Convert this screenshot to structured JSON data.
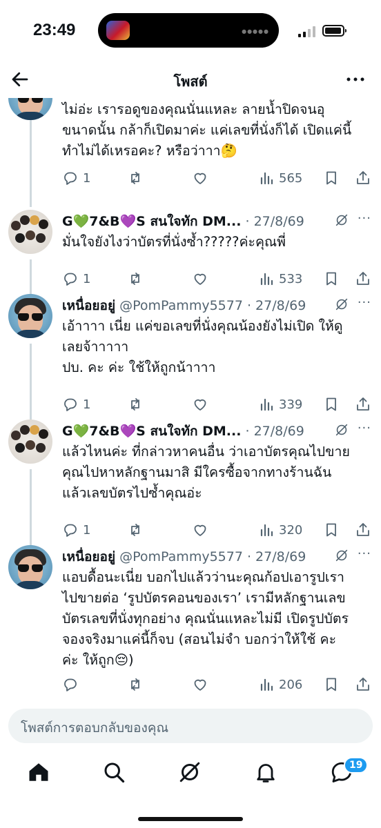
{
  "status_bar": {
    "time": "23:49"
  },
  "header": {
    "title": "โพสต์"
  },
  "icons": {
    "back": "arrow-left-icon",
    "more": "ellipsis-icon",
    "reply": "reply-icon",
    "repost": "repost-icon",
    "like": "heart-icon",
    "views": "views-icon",
    "bookmark": "bookmark-icon",
    "share": "share-icon",
    "grok": "grok-icon",
    "home": "home-icon",
    "search": "search-icon",
    "notifications": "bell-icon",
    "messages": "messages-icon"
  },
  "colors": {
    "text": "#0f1419",
    "secondary": "#536471",
    "accent": "#1d9bf0",
    "thread_line": "#cfd9de",
    "reply_bg": "#eff3f4"
  },
  "tweets": [
    {
      "display_name": "",
      "meta": "",
      "lines": [
        "ไม่อ่ะ เรารอดูของคุณนั่นแหละ ลายน้ำปิดจนอุ",
        "ขนาดนั้น กล้าก็เปิดมาค่ะ แค่เลขที่นั่งก็ได้ เปิดแค่นี้",
        "ทำไม่ได้เหรอคะ? หรือว่าาา🤔"
      ],
      "stats": {
        "replies": "1",
        "reposts": "",
        "likes": "",
        "views": "565"
      }
    },
    {
      "display_name": "G💚7&B💜S สนใจทัก DM...",
      "meta": " · 27/8/69",
      "lines": [
        "มั่นใจยังไงว่าบัตรที่นั่งซ้ำ?????ค่ะคุณพี่"
      ],
      "stats": {
        "replies": "1",
        "reposts": "",
        "likes": "",
        "views": "533"
      }
    },
    {
      "display_name": "เหนื่อยอยู่",
      "meta": " @PomPammy5577 · 27/8/69",
      "lines": [
        "เอ้าาาา เนี่ย แค่ขอเลขที่นั่งคุณน้องยังไม่เปิด ให้ดู",
        "เลยจ้าาาาา",
        "ปบ. คะ ค่ะ ใช้ให้ถูกน้าาาา"
      ],
      "stats": {
        "replies": "1",
        "reposts": "",
        "likes": "",
        "views": "339"
      }
    },
    {
      "display_name": "G💚7&B💜S สนใจทัก DM...",
      "meta": " · 27/8/69",
      "lines": [
        "แล้วไหนค่ะ ที่กล่าวหาคนอื่น ว่าเอาบัตรคุณไปขาย",
        "คุณไปหาหลักฐานมาสิ มีใครซื้อจากทางร้านฉัน",
        "แล้วเลขบัตรไปซ้ำคุณอ่ะ"
      ],
      "stats": {
        "replies": "1",
        "reposts": "",
        "likes": "",
        "views": "320"
      }
    },
    {
      "display_name": "เหนื่อยอยู่",
      "meta": " @PomPammy5577 · 27/8/69",
      "lines": [
        "แอบดื้อนะเนี่ย บอกไปแล้วว่านะคุณก้อปเอารูปเรา",
        "ไปขายต่อ ‘รูปบัตรคอนของเรา’ เรามีหลักฐานเลข",
        "บัตรเลขที่นั่งทุกอย่าง คุณนั่นแหละไม่มี เปิดรูปบัตร",
        "จองจริงมาแค่นี้ก็จบ (สอนไม่จำ บอกว่าให้ใช้ คะ",
        "ค่ะ ให้ถูก😔)"
      ],
      "stats": {
        "replies": "",
        "reposts": "",
        "likes": "",
        "views": "206"
      }
    }
  ],
  "reply_box": {
    "placeholder": "โพสต์การตอบกลับของคุณ"
  },
  "bottom_nav": {
    "messages_badge": "19"
  }
}
